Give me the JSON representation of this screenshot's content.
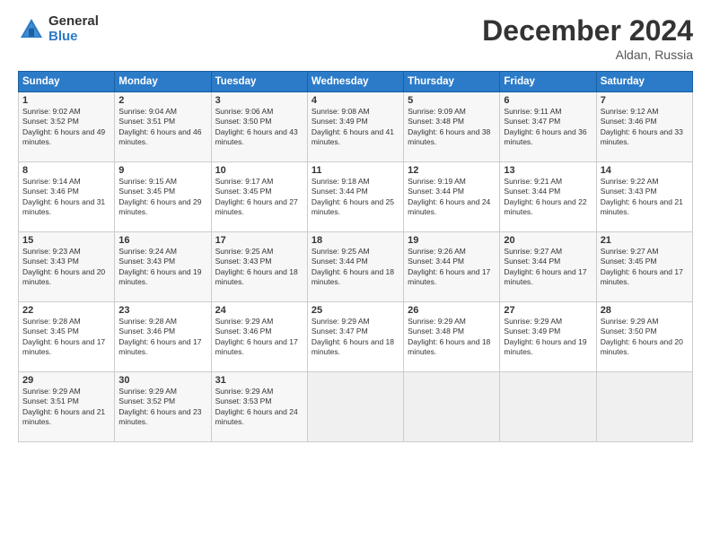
{
  "logo": {
    "general": "General",
    "blue": "Blue"
  },
  "header": {
    "title": "December 2024",
    "location": "Aldan, Russia"
  },
  "days_of_week": [
    "Sunday",
    "Monday",
    "Tuesday",
    "Wednesday",
    "Thursday",
    "Friday",
    "Saturday"
  ],
  "weeks": [
    [
      {
        "day": "1",
        "sunrise": "9:02 AM",
        "sunset": "3:52 PM",
        "daylight": "6 hours and 49 minutes."
      },
      {
        "day": "2",
        "sunrise": "9:04 AM",
        "sunset": "3:51 PM",
        "daylight": "6 hours and 46 minutes."
      },
      {
        "day": "3",
        "sunrise": "9:06 AM",
        "sunset": "3:50 PM",
        "daylight": "6 hours and 43 minutes."
      },
      {
        "day": "4",
        "sunrise": "9:08 AM",
        "sunset": "3:49 PM",
        "daylight": "6 hours and 41 minutes."
      },
      {
        "day": "5",
        "sunrise": "9:09 AM",
        "sunset": "3:48 PM",
        "daylight": "6 hours and 38 minutes."
      },
      {
        "day": "6",
        "sunrise": "9:11 AM",
        "sunset": "3:47 PM",
        "daylight": "6 hours and 36 minutes."
      },
      {
        "day": "7",
        "sunrise": "9:12 AM",
        "sunset": "3:46 PM",
        "daylight": "6 hours and 33 minutes."
      }
    ],
    [
      {
        "day": "8",
        "sunrise": "9:14 AM",
        "sunset": "3:46 PM",
        "daylight": "6 hours and 31 minutes."
      },
      {
        "day": "9",
        "sunrise": "9:15 AM",
        "sunset": "3:45 PM",
        "daylight": "6 hours and 29 minutes."
      },
      {
        "day": "10",
        "sunrise": "9:17 AM",
        "sunset": "3:45 PM",
        "daylight": "6 hours and 27 minutes."
      },
      {
        "day": "11",
        "sunrise": "9:18 AM",
        "sunset": "3:44 PM",
        "daylight": "6 hours and 25 minutes."
      },
      {
        "day": "12",
        "sunrise": "9:19 AM",
        "sunset": "3:44 PM",
        "daylight": "6 hours and 24 minutes."
      },
      {
        "day": "13",
        "sunrise": "9:21 AM",
        "sunset": "3:44 PM",
        "daylight": "6 hours and 22 minutes."
      },
      {
        "day": "14",
        "sunrise": "9:22 AM",
        "sunset": "3:43 PM",
        "daylight": "6 hours and 21 minutes."
      }
    ],
    [
      {
        "day": "15",
        "sunrise": "9:23 AM",
        "sunset": "3:43 PM",
        "daylight": "6 hours and 20 minutes."
      },
      {
        "day": "16",
        "sunrise": "9:24 AM",
        "sunset": "3:43 PM",
        "daylight": "6 hours and 19 minutes."
      },
      {
        "day": "17",
        "sunrise": "9:25 AM",
        "sunset": "3:43 PM",
        "daylight": "6 hours and 18 minutes."
      },
      {
        "day": "18",
        "sunrise": "9:25 AM",
        "sunset": "3:44 PM",
        "daylight": "6 hours and 18 minutes."
      },
      {
        "day": "19",
        "sunrise": "9:26 AM",
        "sunset": "3:44 PM",
        "daylight": "6 hours and 17 minutes."
      },
      {
        "day": "20",
        "sunrise": "9:27 AM",
        "sunset": "3:44 PM",
        "daylight": "6 hours and 17 minutes."
      },
      {
        "day": "21",
        "sunrise": "9:27 AM",
        "sunset": "3:45 PM",
        "daylight": "6 hours and 17 minutes."
      }
    ],
    [
      {
        "day": "22",
        "sunrise": "9:28 AM",
        "sunset": "3:45 PM",
        "daylight": "6 hours and 17 minutes."
      },
      {
        "day": "23",
        "sunrise": "9:28 AM",
        "sunset": "3:46 PM",
        "daylight": "6 hours and 17 minutes."
      },
      {
        "day": "24",
        "sunrise": "9:29 AM",
        "sunset": "3:46 PM",
        "daylight": "6 hours and 17 minutes."
      },
      {
        "day": "25",
        "sunrise": "9:29 AM",
        "sunset": "3:47 PM",
        "daylight": "6 hours and 18 minutes."
      },
      {
        "day": "26",
        "sunrise": "9:29 AM",
        "sunset": "3:48 PM",
        "daylight": "6 hours and 18 minutes."
      },
      {
        "day": "27",
        "sunrise": "9:29 AM",
        "sunset": "3:49 PM",
        "daylight": "6 hours and 19 minutes."
      },
      {
        "day": "28",
        "sunrise": "9:29 AM",
        "sunset": "3:50 PM",
        "daylight": "6 hours and 20 minutes."
      }
    ],
    [
      {
        "day": "29",
        "sunrise": "9:29 AM",
        "sunset": "3:51 PM",
        "daylight": "6 hours and 21 minutes."
      },
      {
        "day": "30",
        "sunrise": "9:29 AM",
        "sunset": "3:52 PM",
        "daylight": "6 hours and 23 minutes."
      },
      {
        "day": "31",
        "sunrise": "9:29 AM",
        "sunset": "3:53 PM",
        "daylight": "6 hours and 24 minutes."
      },
      null,
      null,
      null,
      null
    ]
  ]
}
